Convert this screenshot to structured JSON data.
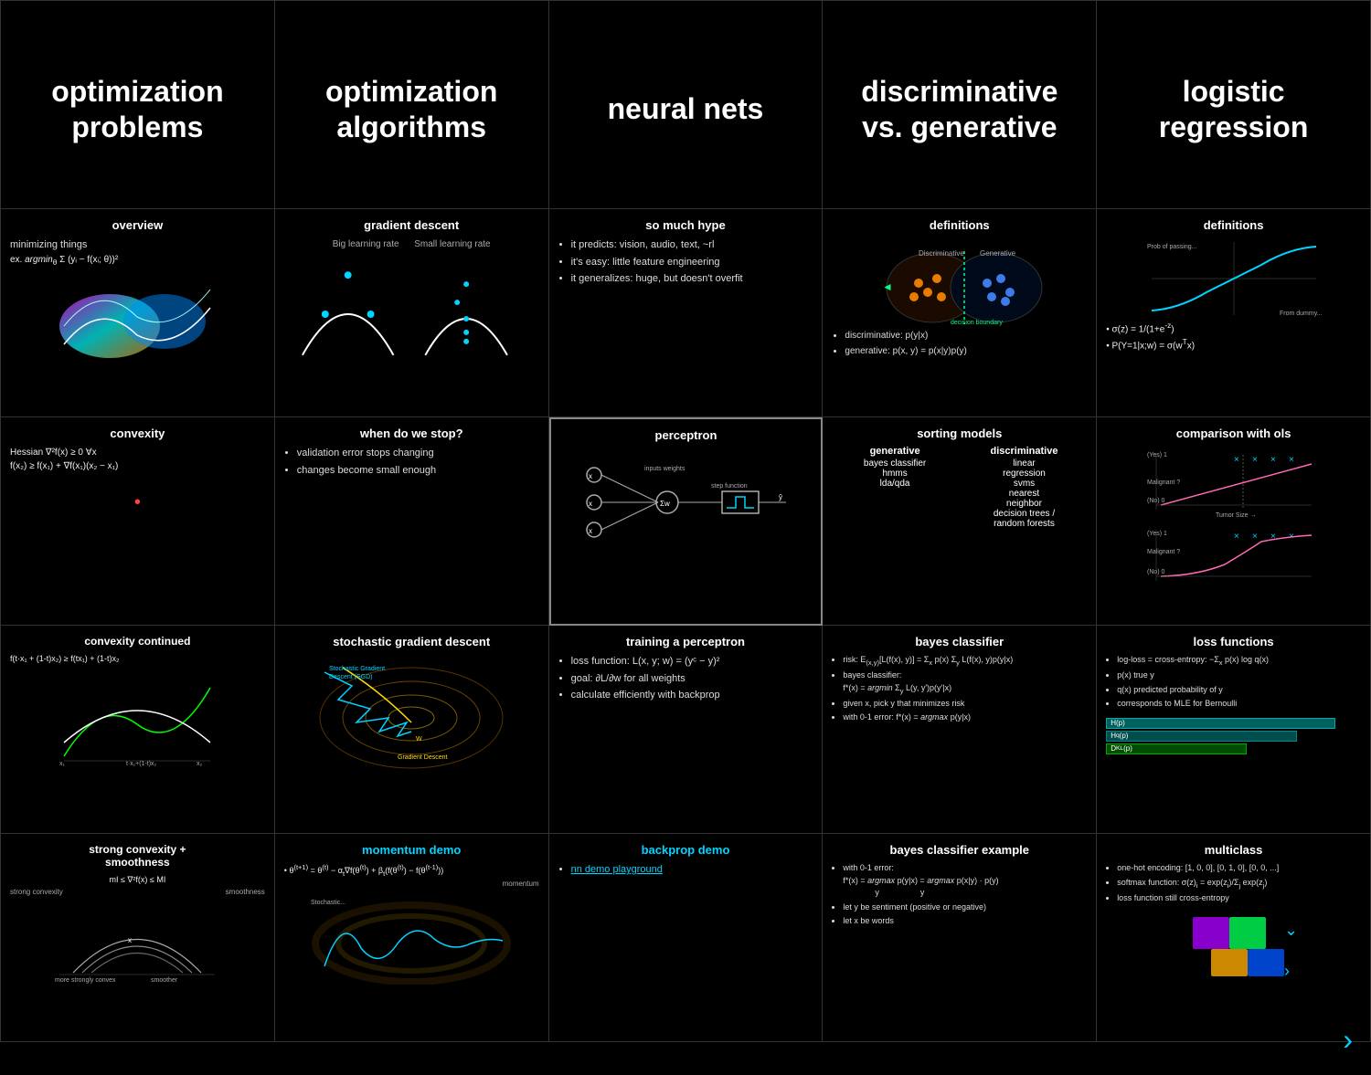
{
  "grid": {
    "rows": [
      {
        "cells": [
          {
            "id": "opt-problems",
            "type": "header",
            "title": "optimization problems",
            "hasImage": true
          },
          {
            "id": "opt-algorithms",
            "type": "header",
            "title": "optimization algorithms",
            "hasImage": false
          },
          {
            "id": "neural-nets",
            "type": "header",
            "title": "neural nets",
            "hasImage": false
          },
          {
            "id": "disc-gen",
            "type": "header",
            "title": "discriminative vs. generative",
            "hasImage": false
          },
          {
            "id": "logistic-reg",
            "type": "header",
            "title": "logistic regression",
            "hasImage": false
          }
        ]
      },
      {
        "cells": [
          {
            "id": "overview",
            "subtitle": "overview",
            "body": "minimizing things\nex. argmin Σ(yᵢ - f(xᵢ;θ))²",
            "hasImage": true
          },
          {
            "id": "gradient-descent",
            "subtitle": "gradient descent",
            "body": "Big learning rate    Small learning rate",
            "hasImage": true
          },
          {
            "id": "so-much-hype",
            "subtitle": "so much hype",
            "bullets": [
              "it predicts: vision, audio, text, ~rl",
              "it's easy: little feature engineering",
              "it generalizes: huge, but doesn't overfit"
            ]
          },
          {
            "id": "definitions-1",
            "subtitle": "definitions",
            "hasImage": true,
            "bullets": [
              "discriminative: p(y|x)",
              "generative: p(x, y) = p(x|y)p(y)"
            ]
          },
          {
            "id": "definitions-2",
            "subtitle": "definitions",
            "hasImage": true,
            "bullets": [
              "σ(z) = 1/(1+e⁻ᶻ)",
              "P(Y=1|x;w) = σ(wᵀx)"
            ]
          }
        ]
      },
      {
        "cells": [
          {
            "id": "convexity",
            "subtitle": "convexity",
            "body": "Hessian ∇²f(x) ≥ 0 ∀x\nf(x₂) ≥ f(x₁) + ∇f(x₁)(x₂ - x₁)",
            "hasImage": false
          },
          {
            "id": "when-stop",
            "subtitle": "when do we stop?",
            "bullets": [
              "validation error stops changing",
              "changes become small enough"
            ]
          },
          {
            "id": "perceptron",
            "subtitle": "perceptron",
            "highlighted": true,
            "hasImage": true
          },
          {
            "id": "sorting-models",
            "subtitle": "sorting models",
            "generative": [
              "bayes classifier",
              "hmms",
              "lda/qda"
            ],
            "discriminative": [
              "linear",
              "regression",
              "svms",
              "nearest neighbor",
              "decision trees / random forests"
            ]
          },
          {
            "id": "comparison-ols",
            "subtitle": "comparison with ols",
            "hasImage": true
          }
        ]
      },
      {
        "cells": [
          {
            "id": "convexity-cont",
            "subtitle": "convexity continued",
            "body": "f(t·x₁ + (1 - t)x₂) ≥ f(tx₁ + (1 - t)x₂)",
            "hasImage": true
          },
          {
            "id": "sgd",
            "subtitle": "stochastic gradient descent",
            "hasImage": true
          },
          {
            "id": "training-perceptron",
            "subtitle": "training a perceptron",
            "bullets": [
              "loss function: L(x, y; w) = (yᶜ - y)²",
              "goal: ∂L/∂w for all weights",
              "calculate efficiently with backprop"
            ]
          },
          {
            "id": "bayes-classifier",
            "subtitle": "bayes classifier",
            "bullets": [
              "risk: E₍ₓ,y₎[L(f(x), y)] = Σₓ p(x) Σy L(f(x), y)p(y|x)",
              "bayes classifier: f*(x) = argmin Σy L(y,y')p(y'|x)",
              "given x, pick y that minimizes risk",
              "with 0-1 error: f*(x) = argmax p(y|x)"
            ]
          },
          {
            "id": "loss-functions",
            "subtitle": "loss functions",
            "bullets": [
              "log-loss = cross-entropy: -Σₓ p(x) log q(x)",
              "p(x) true y",
              "q(x) predicted probability of y",
              "corresponds to MLE for Bernoulli"
            ],
            "hasBar": true
          }
        ]
      },
      {
        "cells": [
          {
            "id": "strong-convexity",
            "subtitle": "strong convexity + smoothness",
            "body": "mI ≤ ∇²f(x) ≤ MI\nstrong convexity    smoothness",
            "hasImage": true
          },
          {
            "id": "momentum-demo",
            "subtitle": "momentum demo",
            "cyan": true,
            "body": "θ⁽ᵗ⁺¹⁾ = θ⁽ᵗ⁾ - αₜ∇f(θ⁽ᵗ⁾) + βₜ(f(θ⁽ᵗ⁾) - f(θ⁽ᵗ⁻¹⁾))\nmomentum",
            "hasImage": true
          },
          {
            "id": "backprop-demo",
            "subtitle": "backprop demo",
            "cyan": true,
            "bullets": [
              "nn demo playground"
            ]
          },
          {
            "id": "bayes-classifier-example",
            "subtitle": "bayes classifier example",
            "bullets": [
              "with 0-1 error: f*(x) = argmax p(y|x) = argmax p(x|y) · p(y)",
              "let y be sentiment (positive or negative)",
              "let x be words"
            ]
          },
          {
            "id": "multiclass",
            "subtitle": "multiclass",
            "bullets": [
              "one-hot encoding: [1, 0, 0], [0, 1, 0], [0, 0, ...]",
              "softmax function: σ(z)ᵢ = exp(zᵢ)/Σⱼ exp(zⱼ)",
              "loss function still cross-entropy"
            ],
            "hasImage": true
          }
        ]
      }
    ]
  },
  "nav": {
    "arrow": "›"
  }
}
